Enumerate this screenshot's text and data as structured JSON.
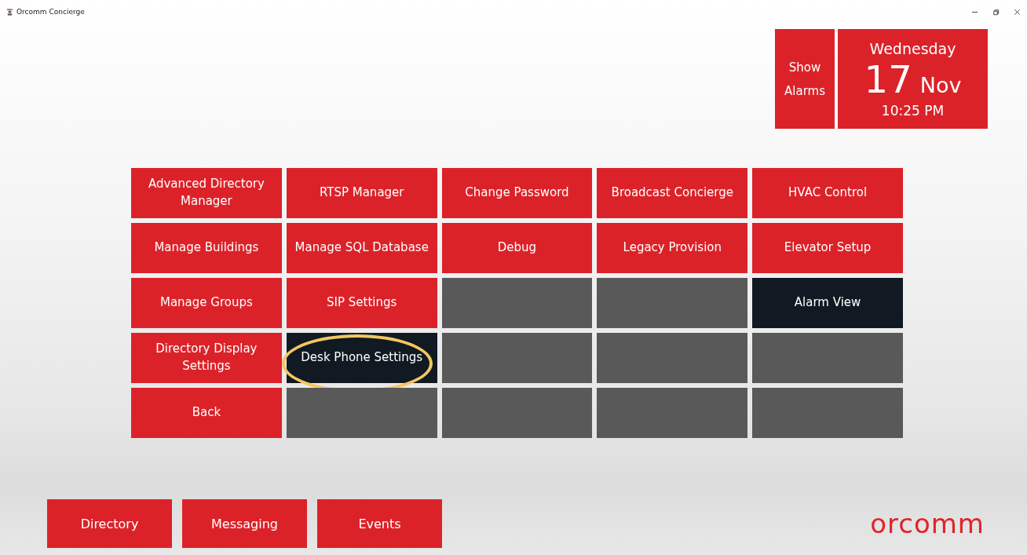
{
  "window": {
    "title": "Orcomm Concierge"
  },
  "alarms_button": {
    "line1": "Show",
    "line2": "Alarms"
  },
  "clock": {
    "weekday": "Wednesday",
    "day": "17",
    "month": "Nov",
    "time": "10:25 PM"
  },
  "tiles": [
    {
      "label": "Advanced Directory Manager",
      "kind": "red",
      "highlighted": false
    },
    {
      "label": "RTSP Manager",
      "kind": "red",
      "highlighted": false
    },
    {
      "label": "Change Password",
      "kind": "red",
      "highlighted": false
    },
    {
      "label": "Broadcast Concierge",
      "kind": "red",
      "highlighted": false
    },
    {
      "label": "HVAC Control",
      "kind": "red",
      "highlighted": false
    },
    {
      "label": "Manage Buildings",
      "kind": "red",
      "highlighted": false
    },
    {
      "label": "Manage SQL Database",
      "kind": "red",
      "highlighted": false
    },
    {
      "label": "Debug",
      "kind": "red",
      "highlighted": false
    },
    {
      "label": "Legacy Provision",
      "kind": "red",
      "highlighted": false
    },
    {
      "label": "Elevator Setup",
      "kind": "red",
      "highlighted": false
    },
    {
      "label": "Manage Groups",
      "kind": "red",
      "highlighted": false
    },
    {
      "label": "SIP Settings",
      "kind": "red",
      "highlighted": false
    },
    {
      "kind": "empty",
      "highlighted": false
    },
    {
      "kind": "empty",
      "highlighted": false
    },
    {
      "label": "Alarm View",
      "kind": "dark",
      "highlighted": false
    },
    {
      "label": "Directory Display Settings",
      "kind": "red",
      "highlighted": false
    },
    {
      "label": "Desk Phone Settings",
      "kind": "dark",
      "highlighted": true
    },
    {
      "kind": "empty",
      "highlighted": false
    },
    {
      "kind": "empty",
      "highlighted": false
    },
    {
      "kind": "empty",
      "highlighted": false
    },
    {
      "label": "Back",
      "kind": "red",
      "highlighted": false
    },
    {
      "kind": "empty",
      "highlighted": false
    },
    {
      "kind": "empty",
      "highlighted": false
    },
    {
      "kind": "empty",
      "highlighted": false
    },
    {
      "kind": "empty",
      "highlighted": false
    }
  ],
  "nav": [
    "Directory",
    "Messaging",
    "Events"
  ],
  "logo": "orcomm"
}
